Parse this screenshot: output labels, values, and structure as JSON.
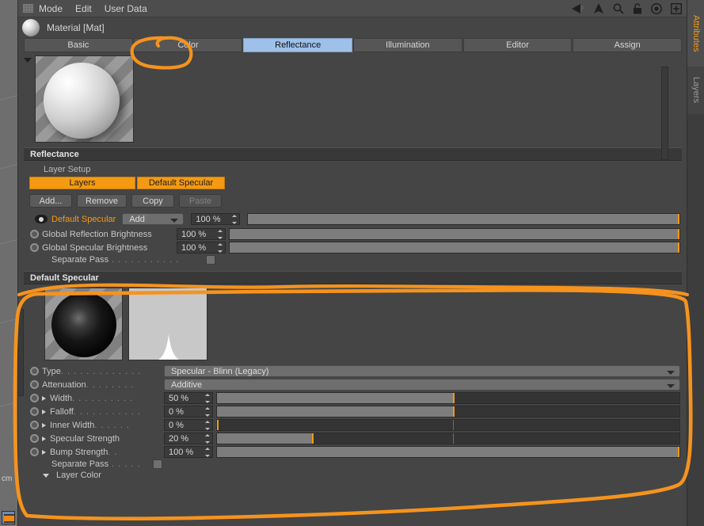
{
  "window": {
    "menu_items": [
      "Mode",
      "Edit",
      "User Data"
    ],
    "grip_icon": "grip-dots-icon",
    "top_icons": [
      {
        "name": "back-arrow-icon",
        "glyph": "◀"
      },
      {
        "name": "up-arrow-icon",
        "glyph": "▲"
      },
      {
        "name": "search-icon",
        "glyph": "⚲"
      },
      {
        "name": "lock-icon",
        "glyph": "⚿"
      },
      {
        "name": "target-icon",
        "glyph": "◎"
      },
      {
        "name": "add-box-icon",
        "glyph": "⊞"
      }
    ],
    "title": "Material [Mat]"
  },
  "tabs": [
    {
      "label": "Basic",
      "selected": false
    },
    {
      "label": "Color",
      "selected": false
    },
    {
      "label": "Reflectance",
      "selected": true
    },
    {
      "label": "Illumination",
      "selected": false
    },
    {
      "label": "Editor",
      "selected": false
    },
    {
      "label": "Assign",
      "selected": false
    }
  ],
  "reflectance": {
    "section_title": "Reflectance",
    "layer_setup_label": "Layer Setup",
    "segments": [
      {
        "label": "Layers",
        "active": true
      },
      {
        "label": "Default Specular",
        "active": true
      }
    ],
    "buttons": [
      {
        "label": "Add...",
        "disabled": false
      },
      {
        "label": "Remove",
        "disabled": false
      },
      {
        "label": "Copy",
        "disabled": false
      },
      {
        "label": "Paste",
        "disabled": true
      }
    ],
    "layer_row": {
      "icon": "eye-icon",
      "name": "Default Specular",
      "blend_mode": "Add",
      "opacity_value": "100 %",
      "opacity_percent": 100
    },
    "globals": [
      {
        "label": "Global Reflection Brightness",
        "value": "100 %",
        "percent": 100
      },
      {
        "label": "Global Specular Brightness",
        "value": "100 %",
        "percent": 100
      }
    ],
    "separate_pass_label": "Separate Pass",
    "separate_pass_dots": ". . . . . . . . . . ."
  },
  "default_specular": {
    "section_title": "Default Specular",
    "preview_sphere": "specular-sphere-preview",
    "preview_curve": "falloff-curve-preview",
    "rows": [
      {
        "label": "Type",
        "dots": ". . . . . . . . . . . . .",
        "kind": "dropdown",
        "value": "Specular - Blinn (Legacy)",
        "indent": false
      },
      {
        "label": "Attenuation",
        "dots": ". . . . . . . .",
        "kind": "dropdown",
        "value": "Additive",
        "indent": false
      },
      {
        "label": "Width",
        "dots": ". . . . . . . . . .",
        "kind": "slider",
        "value": "50 %",
        "percent": 50,
        "indent": true
      },
      {
        "label": "Falloff",
        "dots": ". . . . . . . . . . .",
        "kind": "slider",
        "value": "0 %",
        "percent": 50,
        "indent": true
      },
      {
        "label": "Inner Width",
        "dots": ". . . . . .",
        "kind": "slider",
        "value": "0 %",
        "percent": 0,
        "indent": true
      },
      {
        "label": "Specular Strength",
        "dots": "",
        "kind": "slider",
        "value": "20 %",
        "percent": 20,
        "indent": true
      },
      {
        "label": "Bump Strength",
        "dots": ". .",
        "kind": "slider",
        "value": "100 %",
        "percent": 100,
        "indent": true
      }
    ],
    "separate_pass_label": "Separate Pass",
    "separate_pass_dots": ". . . . .",
    "layer_color_label": "Layer Color"
  },
  "side_tabs": [
    {
      "label": "Attributes",
      "active": true
    },
    {
      "label": "Layers",
      "active": false
    }
  ],
  "viewport": {
    "unit_label": "cm",
    "swatch_icon": "material-swatch-icon"
  },
  "annotation": {
    "color": "#F5931E",
    "marks": [
      "reflectance-tab-circle",
      "default-specular-region-circle"
    ]
  },
  "colors": {
    "accent_orange": "#F49A12",
    "selection_blue": "#9FC0E8",
    "panel_bg": "#454545",
    "header_bg": "#383838",
    "slider_fill": "#7D7D7D",
    "slider_track": "#343434"
  }
}
